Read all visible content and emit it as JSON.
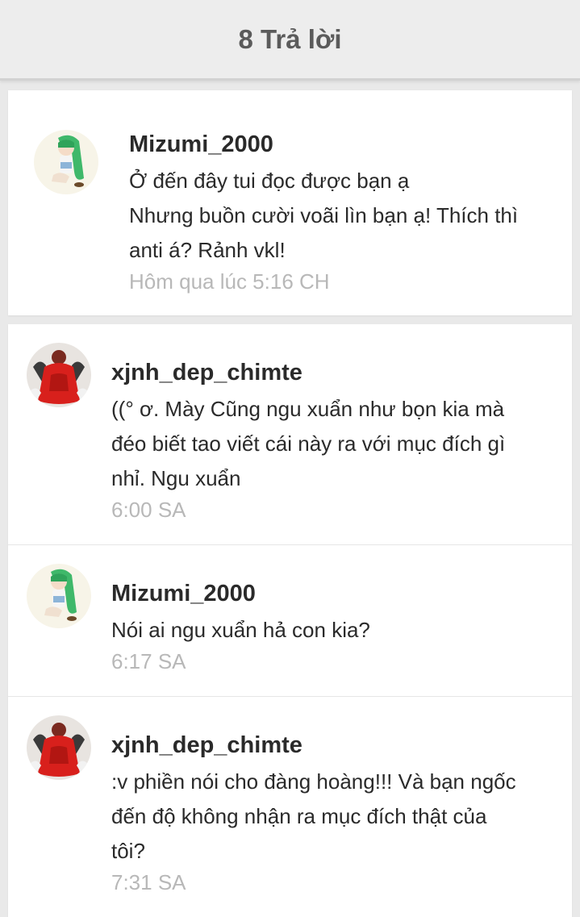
{
  "header": {
    "title": "8 Trả lời"
  },
  "comment": {
    "user": "Mizumi_2000",
    "lines": [
      "Ở đến đây tui đọc được bạn ạ",
      "Nhưng buồn cười voãi lìn bạn ạ! Thích thì",
      "anti á? Rảnh vkl!"
    ],
    "time": "Hôm qua lúc 5:16 CH"
  },
  "replies": [
    {
      "user": "xjnh_dep_chimte",
      "lines": [
        "((° ơ. Mày Cũng ngu xuẩn như bọn kia mà",
        "đéo biết tao viết cái này ra với mục đích gì",
        "nhỉ. Ngu xuẩn"
      ],
      "time": "6:00 SA"
    },
    {
      "user": "Mizumi_2000",
      "lines": [
        "Nói ai ngu xuẩn hả con kia?"
      ],
      "time": "6:17 SA"
    },
    {
      "user": "xjnh_dep_chimte",
      "lines": [
        ":v phiền nói cho đàng hoàng!!! Và bạn ngốc",
        "đến độ không nhận ra mục đích thật của",
        "tôi?"
      ],
      "time": "7:31 SA"
    }
  ],
  "colors": {
    "header_bg": "#ededed",
    "timestamp": "#b8b8b8",
    "avatar_red": "#d8201c",
    "avatar_green": "#4fc26e"
  }
}
